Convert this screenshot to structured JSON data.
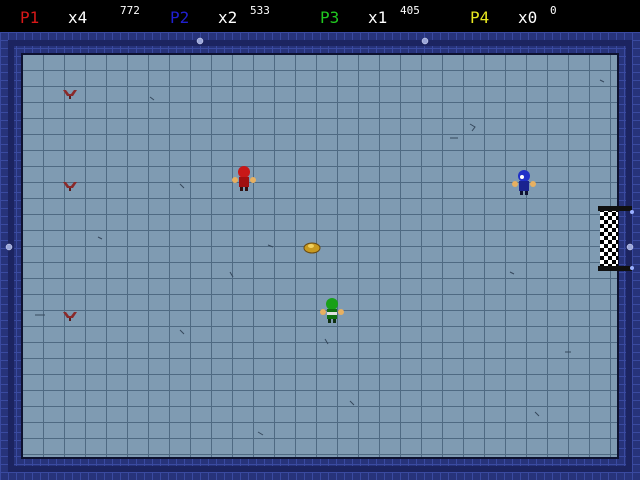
{
  "hud": {
    "players": [
      {
        "tag": "P1",
        "lives": "x4",
        "score": "772",
        "color": "#d81818"
      },
      {
        "tag": "P2",
        "lives": "x2",
        "score": "533",
        "color": "#2020d0"
      },
      {
        "tag": "P3",
        "lives": "x1",
        "score": "405",
        "color": "#20c820"
      },
      {
        "tag": "P4",
        "lives": "x0",
        "score": "0",
        "color": "#e8e820"
      }
    ]
  },
  "arena": {
    "floor_color": "#7f9bb2",
    "grout_color": "#4f6a82",
    "wall_color": "#2c3a8c",
    "goal": "checkered-goal"
  },
  "characters": [
    {
      "name": "red-player-character",
      "color": "#c81818"
    },
    {
      "name": "blue-player-character",
      "color": "#2030c8"
    },
    {
      "name": "green-player-character",
      "color": "#18a018"
    }
  ]
}
